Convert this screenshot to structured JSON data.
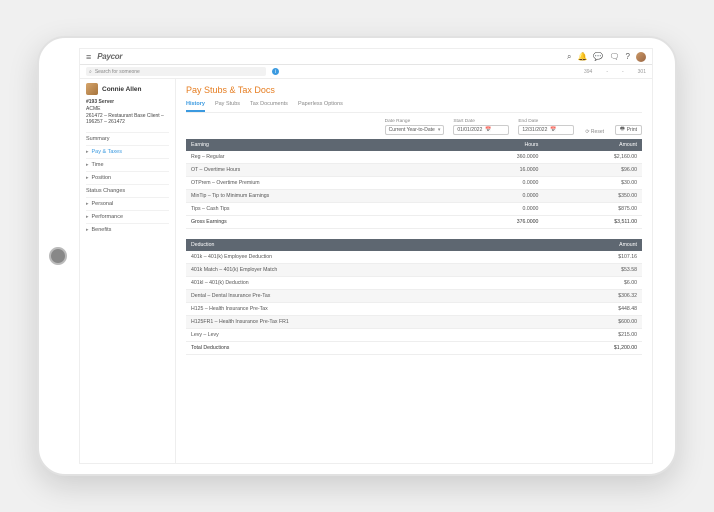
{
  "brand": "Paycor",
  "searchPlaceholder": "Search for someone",
  "subbarRight": [
    "394",
    "-",
    "-",
    "301"
  ],
  "user": {
    "name": "Connie Allen",
    "lines": [
      "#193 Server",
      "ACME",
      "261472 – Restaurant Base Client – 196257 – 261472"
    ]
  },
  "nav": [
    {
      "label": "Summary",
      "active": false,
      "caret": false
    },
    {
      "label": "Pay & Taxes",
      "active": true,
      "caret": true
    },
    {
      "label": "Time",
      "active": false,
      "caret": true
    },
    {
      "label": "Position",
      "active": false,
      "caret": true
    },
    {
      "label": "Status Changes",
      "active": false,
      "caret": false
    },
    {
      "label": "Personal",
      "active": false,
      "caret": true
    },
    {
      "label": "Performance",
      "active": false,
      "caret": true
    },
    {
      "label": "Benefits",
      "active": false,
      "caret": true
    }
  ],
  "pageTitle": "Pay Stubs & Tax Docs",
  "tabs": [
    {
      "label": "History",
      "active": true
    },
    {
      "label": "Pay Stubs",
      "active": false
    },
    {
      "label": "Tax Documents",
      "active": false
    },
    {
      "label": "Paperless Options",
      "active": false
    }
  ],
  "filters": {
    "dateRange": {
      "label": "Date Range",
      "value": "Current Year-to-Date"
    },
    "startDate": {
      "label": "Start Date",
      "value": "01/01/2022"
    },
    "endDate": {
      "label": "End Date",
      "value": "12/31/2022"
    },
    "reset": "Reset",
    "print": "Print"
  },
  "earning": {
    "header": "Earning",
    "colHours": "Hours",
    "colAmount": "Amount",
    "rows": [
      {
        "label": "Reg – Regular",
        "hours": "360.0000",
        "amount": "$2,160.00",
        "alt": false
      },
      {
        "label": "OT – Overtime Hours",
        "hours": "16.0000",
        "amount": "$96.00",
        "alt": true
      },
      {
        "label": "OTPrem – Overtime Premium",
        "hours": "0.0000",
        "amount": "$30.00",
        "alt": false
      },
      {
        "label": "MinTip – Tip to Minimum Earnings",
        "hours": "0.0000",
        "amount": "$350.00",
        "alt": true
      },
      {
        "label": "Tips – Cash Tips",
        "hours": "0.0000",
        "amount": "$875.00",
        "alt": false
      }
    ],
    "total": {
      "label": "Gross Earnings",
      "hours": "376.0000",
      "amount": "$3,511.00"
    }
  },
  "deduction": {
    "header": "Deduction",
    "colAmount": "Amount",
    "rows": [
      {
        "label": "401k – 401(k) Employee Deduction",
        "amount": "$107.16",
        "alt": false
      },
      {
        "label": "401k Match – 401(k) Employer Match",
        "amount": "$53.58",
        "alt": true
      },
      {
        "label": "401kl – 401(k) Deduction",
        "amount": "$6.00",
        "alt": false
      },
      {
        "label": "Dental – Dental Insurance Pre-Tax",
        "amount": "$306.32",
        "alt": true
      },
      {
        "label": "H125 – Health Insurance Pre-Tax",
        "amount": "$448.48",
        "alt": false
      },
      {
        "label": "H125FR1 – Health Insurance Pre-Tax FR1",
        "amount": "$600.00",
        "alt": true
      },
      {
        "label": "Levy – Levy",
        "amount": "$215.00",
        "alt": false
      }
    ],
    "total": {
      "label": "Total Deductions",
      "amount": "$1,200.00"
    }
  }
}
